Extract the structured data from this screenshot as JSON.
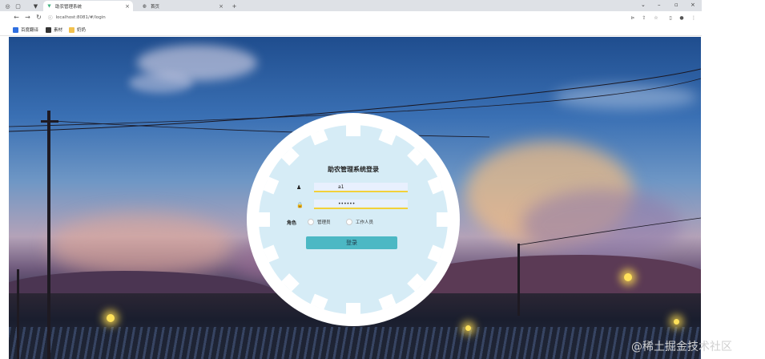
{
  "browser": {
    "tabs": [
      {
        "title": "助农管理系统",
        "active": true
      },
      {
        "title": "首页",
        "active": false
      }
    ],
    "new_tab": "+",
    "url": "localhost:8081/#/login",
    "bookmarks": [
      {
        "label": "百度翻译",
        "icon": "translate-icon",
        "color": "#2f6fe0"
      },
      {
        "label": "素材",
        "icon": "image-icon",
        "color": "#333333"
      },
      {
        "label": "奶奶",
        "icon": "folder-icon",
        "color": "#f2c14e"
      }
    ]
  },
  "login": {
    "title": "助农管理系统登录",
    "username_value": "a1",
    "password_value": "••••••",
    "role_label": "角色",
    "roles": [
      "管理员",
      "工作人员"
    ],
    "submit_label": "登录"
  },
  "watermark": "@稀土掘金技术社区",
  "colors": {
    "gear_panel": "#d6ecf6",
    "gear_outer": "#ffffff",
    "button": "#4cb8c4",
    "input_underline": "#f2d13a"
  }
}
